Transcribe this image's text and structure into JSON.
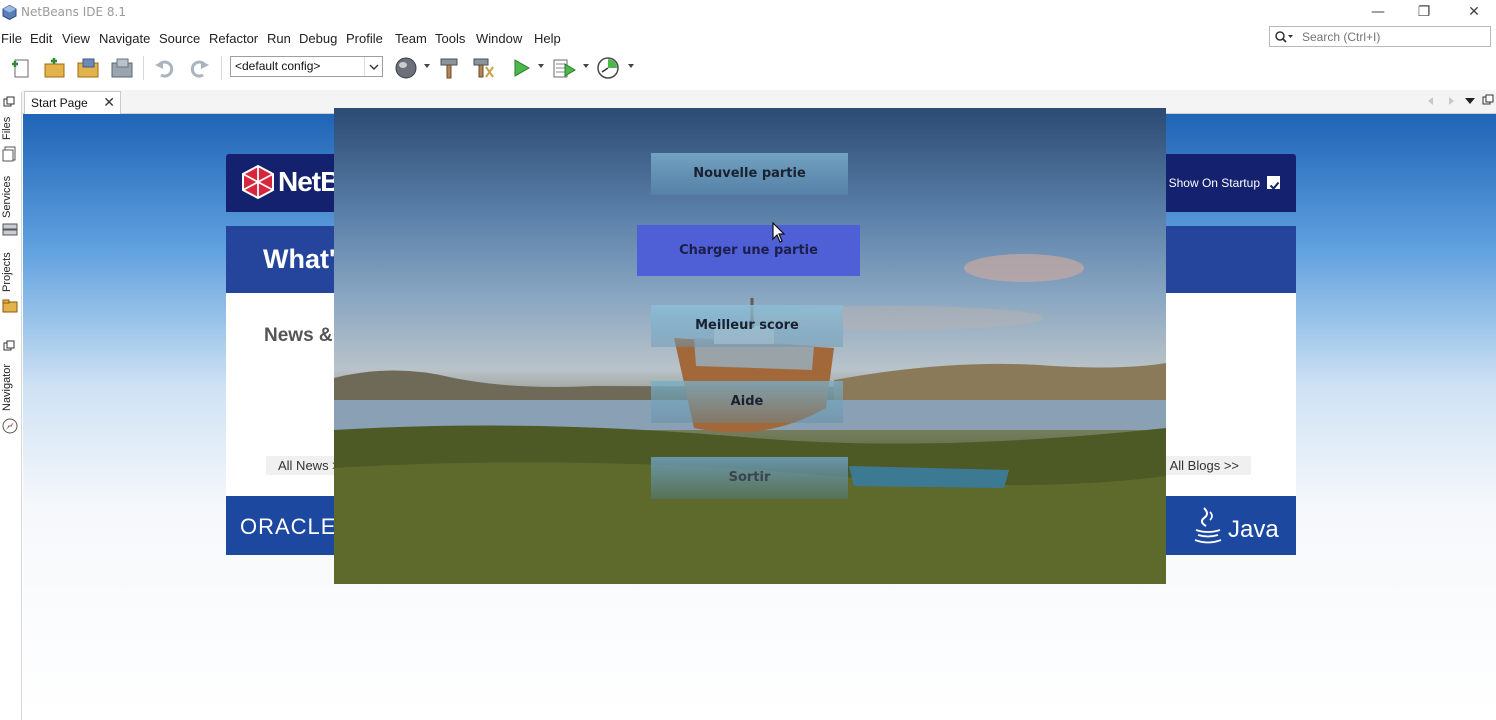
{
  "window": {
    "title": "NetBeans IDE 8.1",
    "minimize": "—",
    "restore": "❐",
    "close": "✕"
  },
  "menu": [
    "File",
    "Edit",
    "View",
    "Navigate",
    "Source",
    "Refactor",
    "Run",
    "Debug",
    "Profile",
    "Team",
    "Tools",
    "Window",
    "Help"
  ],
  "search": {
    "placeholder": "Search (Ctrl+I)"
  },
  "toolbar": {
    "config": "<default config>"
  },
  "sidebar": {
    "files": "Files",
    "services": "Services",
    "projects": "Projects",
    "navigator": "Navigator"
  },
  "editor": {
    "tab_label": "Start Page",
    "tab_close": "✕"
  },
  "startpage": {
    "logo": "NetBeans",
    "show_on_startup": "Show On Startup",
    "band_title": "What's New",
    "news_heading": "News & Announcements",
    "all_news": "All News >>",
    "all_blogs": "All Blogs >>",
    "oracle": "ORACLE",
    "java": "Java"
  },
  "game": {
    "buttons": {
      "new_game": "Nouvelle partie",
      "load_game": "Charger une partie",
      "high_score": "Meilleur score",
      "help": "Aide",
      "exit": "Sortir"
    }
  },
  "colors": {
    "title_text": "#9a9a9a",
    "netbeans_navy": "#13216e",
    "startpage_band": "#24459b",
    "load_button": "#4f5fd6"
  }
}
